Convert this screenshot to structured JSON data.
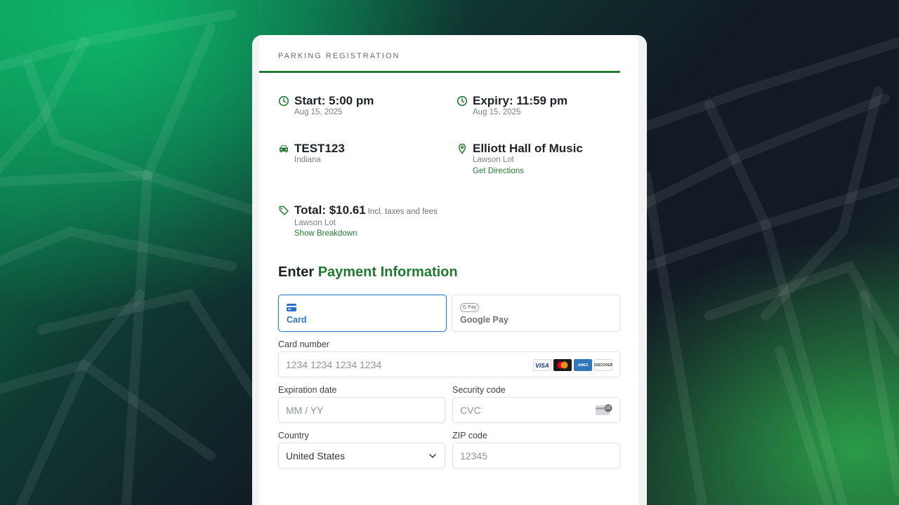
{
  "header": {
    "title": "PARKING REGISTRATION",
    "progress": 1.0
  },
  "start": {
    "title": "Start: 5:00 pm",
    "date": "Aug 15, 2025"
  },
  "expiry": {
    "title": "Expiry: 11:59 pm",
    "date": "Aug 15, 2025"
  },
  "vehicle": {
    "plate": "TEST123",
    "state": "Indiana"
  },
  "location": {
    "name": "Elliott Hall of Music",
    "lot": "Lawson Lot",
    "directions_link": "Get Directions"
  },
  "total": {
    "label": "Total: $10.61",
    "note": "Incl. taxes and fees",
    "lot": "Lawson Lot",
    "breakdown_link": "Show Breakdown"
  },
  "payment": {
    "heading_prefix": "Enter",
    "heading_accent": "Payment Information",
    "methods": [
      {
        "label": "Card",
        "icon": "credit-card-icon",
        "selected": true
      },
      {
        "label": "Google Pay",
        "icon": "google-pay-icon",
        "badge": "G Pay",
        "selected": false
      }
    ],
    "card_number": {
      "label": "Card number",
      "placeholder": "1234 1234 1234 1234",
      "value": ""
    },
    "card_brands": {
      "visa": "VISA",
      "amex": "AMEX",
      "discover": "DISCOVER"
    },
    "expiration": {
      "label": "Expiration date",
      "placeholder": "MM / YY",
      "value": ""
    },
    "security": {
      "label": "Security code",
      "placeholder": "CVC",
      "value": "",
      "badge": "135"
    },
    "country": {
      "label": "Country",
      "selected": "United States"
    },
    "zip": {
      "label": "ZIP code",
      "placeholder": "12345",
      "value": ""
    }
  },
  "colors": {
    "accent_green": "#1f7a2c",
    "selected_blue": "#2f7cd6",
    "background_dark": "#111a24"
  }
}
